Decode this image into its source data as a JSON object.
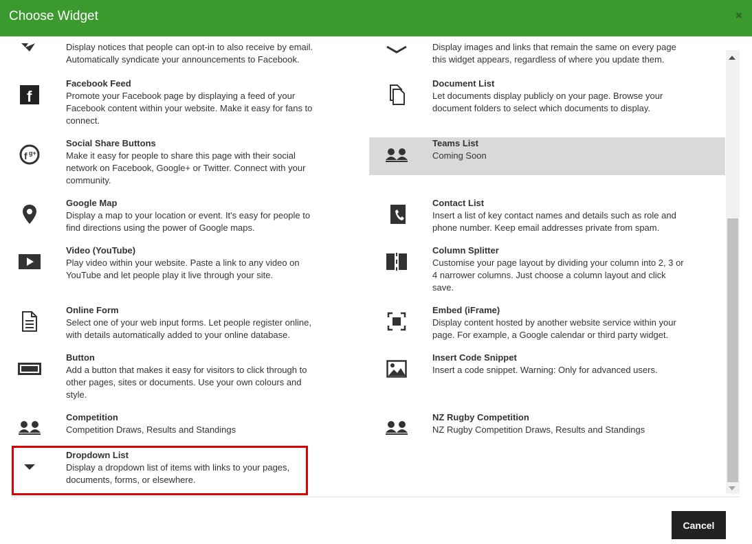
{
  "dialog": {
    "title": "Choose Widget",
    "close_label": "×",
    "cancel_label": "Cancel"
  },
  "colors": {
    "header_bg": "#3a9a2e",
    "selection_outline": "#e00000",
    "highlight_row": "#d9d9d9",
    "cancel_bg": "#222222"
  },
  "widgets": {
    "announcements": {
      "icon": "announcement-icon",
      "desc1": "Display notices that people can opt-in to also receive by email.",
      "desc2": "Automatically syndicate your announcements to Facebook."
    },
    "static_content": {
      "icon": "layers-icon",
      "desc1": "Display images and links that remain the same on every page",
      "desc2": "this widget appears, regardless of where you update them."
    },
    "facebook_feed": {
      "icon": "facebook-icon",
      "title": "Facebook Feed",
      "desc": "Promote your Facebook page by displaying a feed of your Facebook content within your website. Make it easy for fans to connect."
    },
    "document_list": {
      "icon": "documents-icon",
      "title": "Document List",
      "desc": "Let documents display publicly on your page. Browse your document folders to select which documents to display."
    },
    "social_share": {
      "icon": "social-share-icon",
      "title": "Social Share Buttons",
      "desc": "Make it easy for people to share this page with their social network on Facebook, Google+ or Twitter. Connect with your community."
    },
    "teams_list": {
      "icon": "people-icon",
      "title": "Teams List",
      "desc": "Coming Soon"
    },
    "google_map": {
      "icon": "map-pin-icon",
      "title": "Google Map",
      "desc": "Display a map to your location or event. It's easy for people to find directions using the power of Google maps."
    },
    "contact_list": {
      "icon": "contact-phone-icon",
      "title": "Contact List",
      "desc": "Insert a list of key contact names and details such as role and phone number. Keep email addresses private from spam."
    },
    "video": {
      "icon": "video-play-icon",
      "title": "Video (YouTube)",
      "desc": "Play video within your website. Paste a link to any video on YouTube and let people play it live through your site."
    },
    "column_splitter": {
      "icon": "column-split-icon",
      "title": "Column Splitter",
      "desc": "Customise your page layout by dividing your column into 2, 3 or 4 narrower columns. Just choose a column layout and click save."
    },
    "online_form": {
      "icon": "form-document-icon",
      "title": "Online Form",
      "desc": "Select one of your web input forms. Let people register online, with details automatically added to your online database."
    },
    "embed": {
      "icon": "embed-frame-icon",
      "title": "Embed (iFrame)",
      "desc": "Display content hosted by another website service within your page. For example, a Google calendar or third party widget."
    },
    "button": {
      "icon": "button-rect-icon",
      "title": "Button",
      "desc": "Add a button that makes it easy for visitors to click through to other pages, sites or documents. Use your own colours and style."
    },
    "code_snippet": {
      "icon": "image-icon",
      "title": "Insert Code Snippet",
      "desc": "Insert a code snippet. Warning: Only for advanced users."
    },
    "competition": {
      "icon": "people-icon",
      "title": "Competition",
      "desc": "Competition Draws, Results and Standings"
    },
    "nz_rugby": {
      "icon": "people-icon",
      "title": "NZ Rugby Competition",
      "desc": "NZ Rugby Competition Draws, Results and Standings"
    },
    "dropdown_list": {
      "icon": "caret-down-icon",
      "title": "Dropdown List",
      "desc": "Display a dropdown list of items with links to your pages, documents, forms, or elsewhere."
    }
  }
}
